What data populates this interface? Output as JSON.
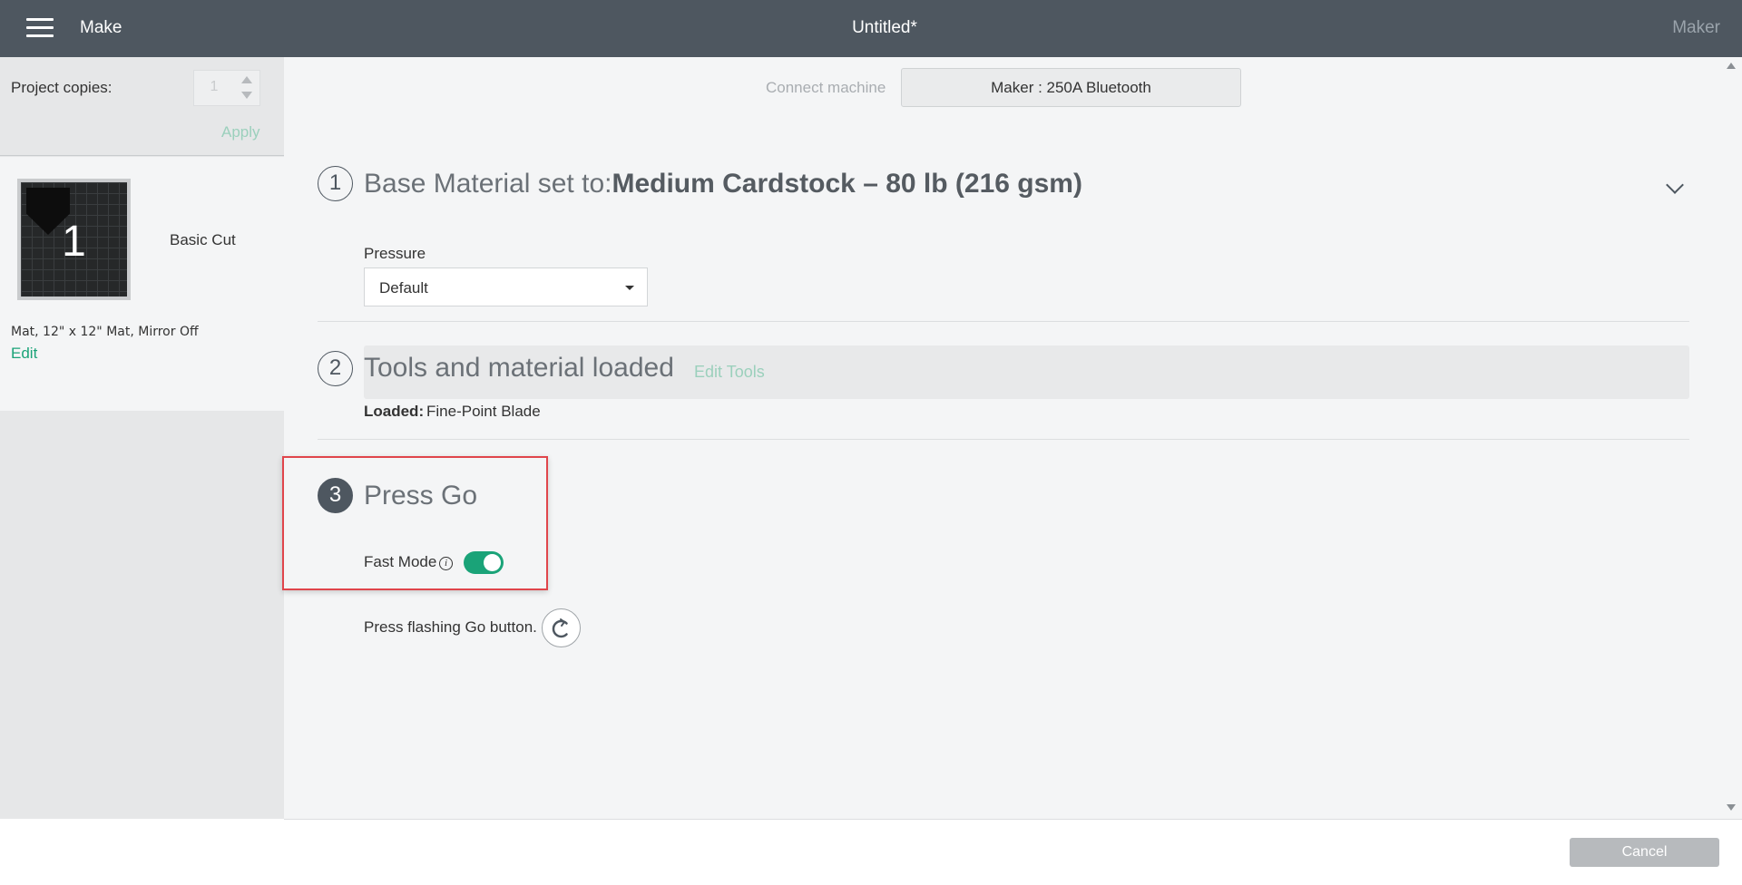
{
  "header": {
    "menu_icon": "hamburger-menu-icon",
    "screen_label": "Make",
    "project_title": "Untitled*",
    "machine_family": "Maker"
  },
  "sidebar": {
    "copies_label": "Project copies:",
    "copies_value": "1",
    "apply_label": "Apply",
    "mat": {
      "number": "1",
      "label": "Basic Cut",
      "description": "Mat, 12\" x 12\" Mat, Mirror Off",
      "edit_label": "Edit"
    }
  },
  "main": {
    "connect_label": "Connect machine",
    "machine_button": "Maker : 250A Bluetooth",
    "step1": {
      "number": "1",
      "title_prefix": "Base Material set to:",
      "material": "Medium Cardstock – 80 lb (216 gsm)",
      "pressure_label": "Pressure",
      "pressure_value": "Default",
      "pressure_options": [
        "Default"
      ]
    },
    "step2": {
      "number": "2",
      "title": "Tools and material loaded",
      "edit_tools_label": "Edit Tools",
      "loaded_label": "Loaded:",
      "loaded_value": "Fine-Point Blade"
    },
    "step3": {
      "number": "3",
      "title": "Press Go",
      "fast_mode_label": "Fast Mode",
      "fast_mode_on": true,
      "instruction": "Press flashing Go button."
    }
  },
  "footer": {
    "cancel_label": "Cancel"
  },
  "colors": {
    "header_bg": "#4e5760",
    "accent_green": "#1aa378",
    "highlight_red": "#e0454b",
    "disabled_btn": "#b7babd"
  }
}
